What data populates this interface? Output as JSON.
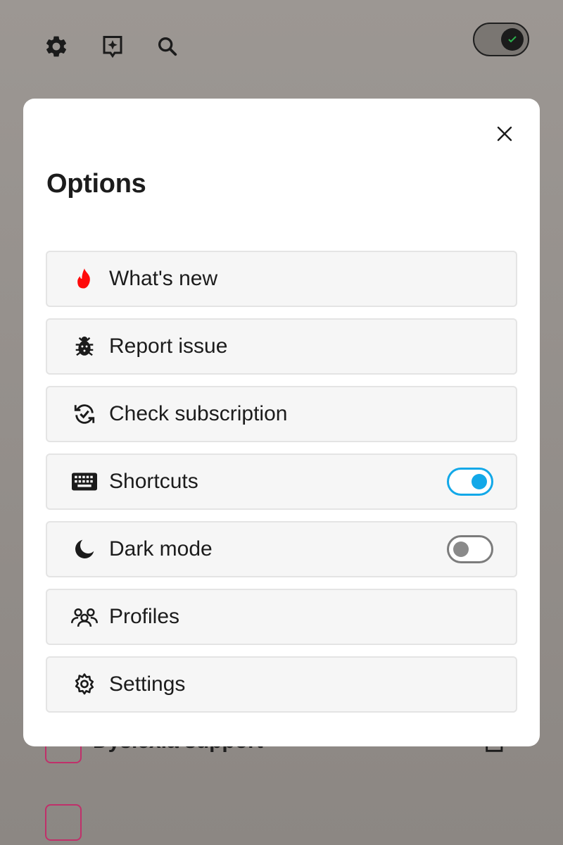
{
  "background": {
    "toolbar_icons": [
      "gear-icon",
      "sparkle-bookmark-icon",
      "search-icon"
    ],
    "power_toggle_on": true,
    "rows": [
      {
        "label": "Dyslexia support",
        "icon": "brain-icon"
      },
      {
        "label": "",
        "icon": "tile-icon"
      }
    ]
  },
  "modal": {
    "title": "Options",
    "close_icon": "close-icon",
    "options": [
      {
        "label": "What's new",
        "icon": "flame-icon",
        "color": "#ff0a0a"
      },
      {
        "label": "Report issue",
        "icon": "bug-icon"
      },
      {
        "label": "Check subscription",
        "icon": "sync-check-icon"
      },
      {
        "label": "Shortcuts",
        "icon": "keyboard-icon",
        "toggle_on": true
      },
      {
        "label": "Dark mode",
        "icon": "moon-icon",
        "toggle_on": false
      },
      {
        "label": "Profiles",
        "icon": "users-icon"
      },
      {
        "label": "Settings",
        "icon": "settings-cog-icon"
      }
    ]
  },
  "colors": {
    "accent": "#12a8e8",
    "overlay": "#8f8a86",
    "brand_pink": "#c0306a"
  }
}
